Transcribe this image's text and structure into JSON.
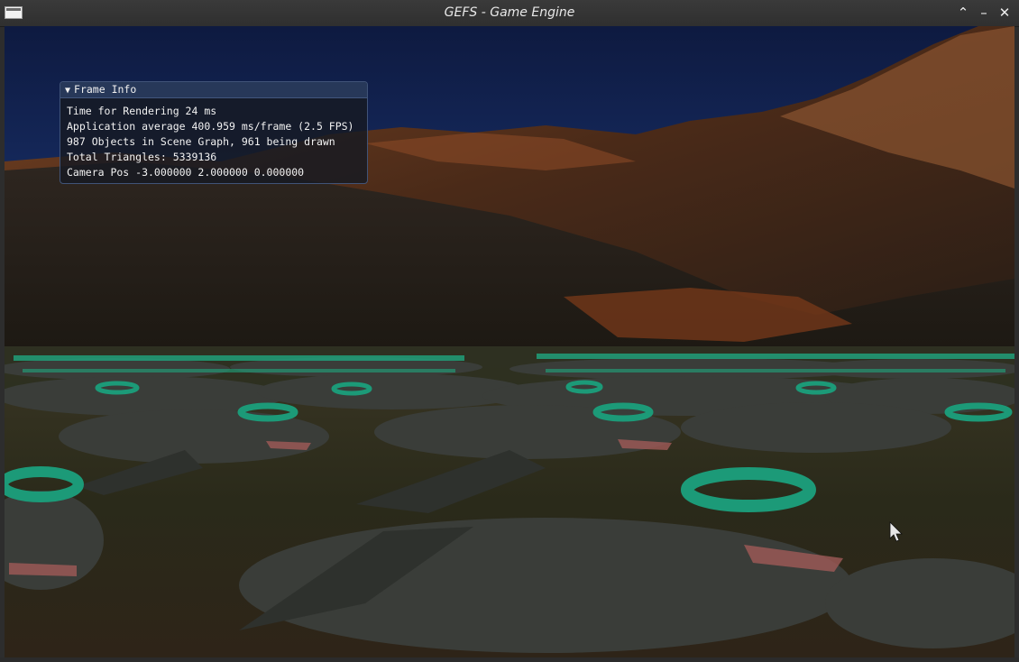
{
  "window": {
    "title": "GEFS - Game Engine",
    "controls": {
      "shade": "⌃",
      "minimize": "–",
      "close": "✕"
    },
    "icons": {
      "app": "window-app-icon"
    }
  },
  "frame_info": {
    "header": "Frame Info",
    "collapse_glyph": "▼",
    "lines": {
      "render_time": "Time for Rendering 24 ms",
      "app_average": "Application average 400.959 ms/frame (2.5 FPS)",
      "objects": "987 Objects in Scene Graph, 961 being drawn",
      "triangles": "Total Triangles: 5339136",
      "camera": "Camera Pos -3.000000 2.000000 0.000000"
    }
  },
  "colors": {
    "sky_top": "#0e1e4a",
    "sky_bottom": "#2c5aa8",
    "mountain": "#6a3a20",
    "ground": "#2a2418",
    "dinosaur": "#3b3e3a",
    "ring": "#1c9a78",
    "panel_header": "#283a5c"
  }
}
